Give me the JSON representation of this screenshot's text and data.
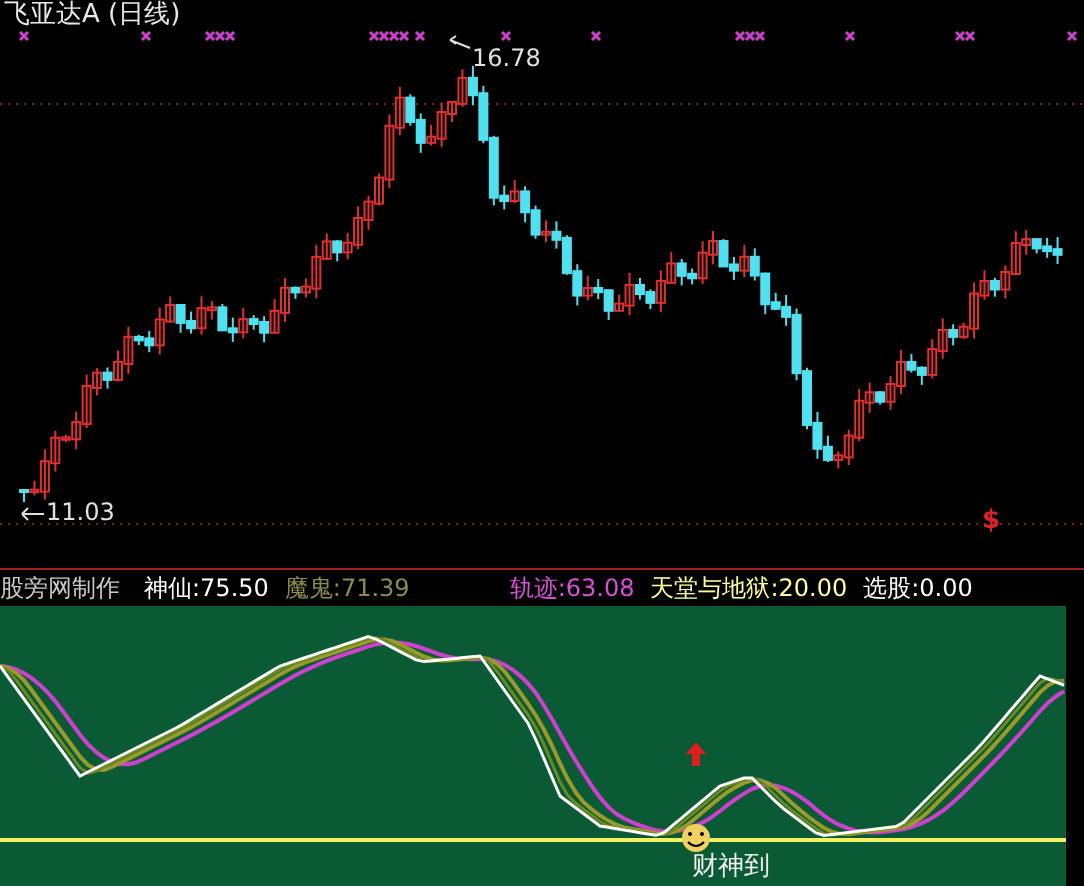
{
  "header": {
    "title": "飞亚达A (日线)"
  },
  "price_chart": {
    "high_label": "16.78",
    "low_label": "11.03",
    "signal_mark": "$"
  },
  "legend": [
    {
      "label": "股旁网制作",
      "kind": "credit"
    },
    {
      "label": "神仙:75.50",
      "kind": "fast"
    },
    {
      "label": "魔鬼:71.39",
      "kind": "medium"
    },
    {
      "label": "轨迹:63.08",
      "kind": "slow"
    },
    {
      "label": "天堂与地狱:20.00",
      "kind": "baseline"
    },
    {
      "label": "选股:0.00",
      "kind": "screen"
    }
  ],
  "indicator": {
    "signal_label": "财神到"
  }
}
